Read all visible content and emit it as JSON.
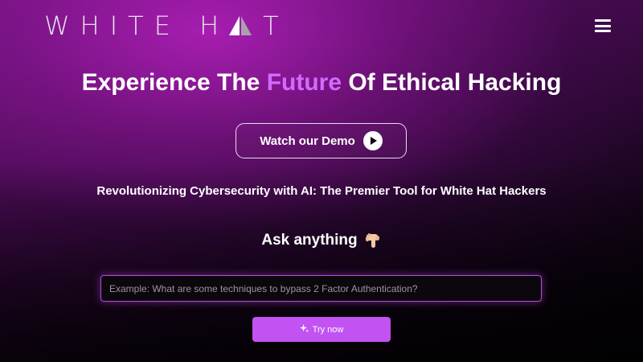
{
  "header": {
    "logo_text": "WHITE H",
    "logo_end": "T",
    "menu_icon": "hamburger-menu-icon"
  },
  "hero": {
    "title_before": "Experience The ",
    "title_accent": "Future",
    "title_after": " Of Ethical Hacking",
    "demo_label": "Watch our Demo",
    "subtitle": "Revolutionizing Cybersecurity with AI: The Premier Tool for White Hat Hackers"
  },
  "prompt": {
    "heading": "Ask anything",
    "input_value": "",
    "input_placeholder": "Example: What are some techniques to bypass 2 Factor Authentication?",
    "submit_label": "Try now"
  },
  "colors": {
    "accent": "#d469ff",
    "button": "#c253f2",
    "input_border": "#b04fd4"
  }
}
